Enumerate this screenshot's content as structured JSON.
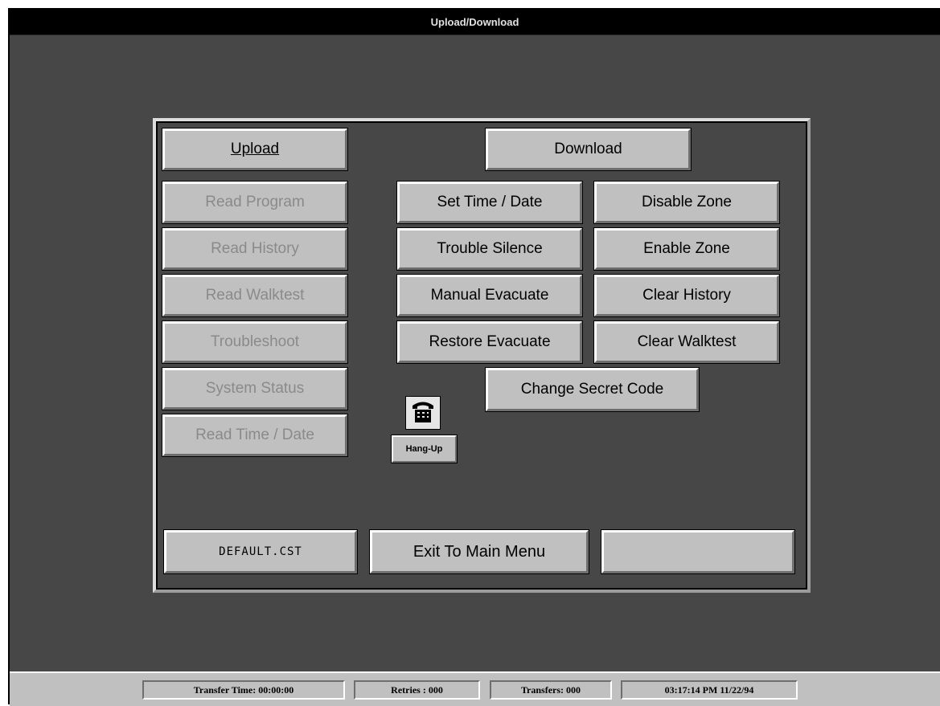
{
  "window": {
    "title": "Upload/Download"
  },
  "upload_column": {
    "header": "Upload",
    "items": [
      "Read Program",
      "Read History",
      "Read Walktest",
      "Troubleshoot",
      "System Status",
      "Read Time / Date"
    ]
  },
  "download_column": {
    "header": "Download",
    "left_items": [
      "Set Time / Date",
      "Trouble Silence",
      "Manual Evacuate",
      "Restore Evacuate"
    ],
    "right_items": [
      "Disable Zone",
      "Enable Zone",
      "Clear History",
      "Clear Walktest"
    ],
    "secret_code": "Change Secret Code"
  },
  "hangup": {
    "label": "Hang-Up",
    "icon": "telephone-icon"
  },
  "footer": {
    "file_label": "DEFAULT.CST",
    "exit_label": "Exit To Main Menu",
    "blank_label": ""
  },
  "statusbar": {
    "transfer_time": "Transfer Time: 00:00:00",
    "retries": "Retries :  000",
    "transfers": "Transfers: 000",
    "datetime": "03:17:14 PM 11/22/94"
  }
}
